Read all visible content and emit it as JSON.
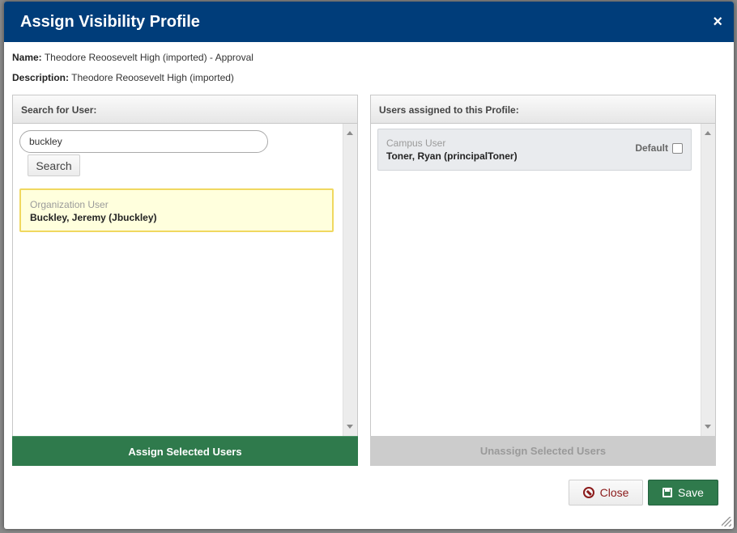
{
  "dialog": {
    "title": "Assign Visibility Profile",
    "close_glyph": "×"
  },
  "profile": {
    "name_label": "Name:",
    "name_value": "Theodore Reoosevelt High (imported) - Approval",
    "description_label": "Description:",
    "description_value": "Theodore Reoosevelt High (imported)"
  },
  "search_panel": {
    "heading": "Search for User:",
    "query": "buckley",
    "search_button": "Search",
    "results": [
      {
        "role": "Organization User",
        "name": "Buckley, Jeremy (Jbuckley)",
        "selected": true
      }
    ],
    "action": "Assign Selected Users"
  },
  "assigned_panel": {
    "heading": "Users assigned to this Profile:",
    "users": [
      {
        "role": "Campus User",
        "name": "Toner, Ryan (principalToner)",
        "default_label": "Default",
        "is_default": false
      }
    ],
    "action": "Unassign Selected Users"
  },
  "footer": {
    "close_label": "Close",
    "save_label": "Save"
  },
  "icons": {
    "close": "no-entry-icon",
    "save": "floppy-disk-icon"
  },
  "colors": {
    "header_bg": "#003d7a",
    "primary_green": "#2f7a4c",
    "selected_bg": "#ffffdd",
    "selected_border": "#f0d860",
    "disabled_bg": "#cccccc"
  }
}
